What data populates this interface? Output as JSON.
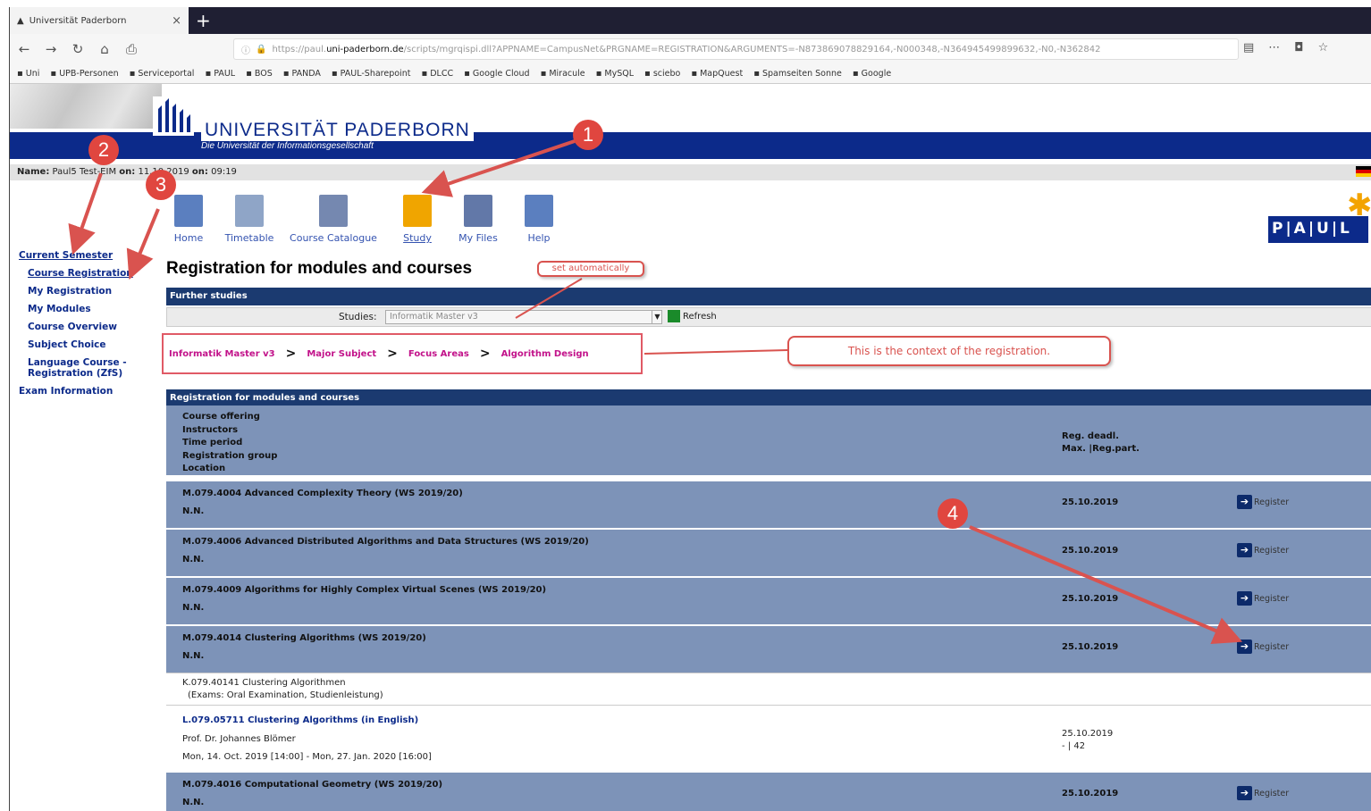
{
  "browser": {
    "tab_title": "Universität Paderborn",
    "url_prefix": "https://paul.",
    "url_domain": "uni-paderborn.de",
    "url_rest": "/scripts/mgrqispi.dll?APPNAME=CampusNet&PRGNAME=REGISTRATION&ARGUMENTS=-N873869078829164,-N000348,-N364945499899632,-N0,-N362842",
    "bookmarks": [
      "Uni",
      "UPB-Personen",
      "Serviceportal",
      "PAUL",
      "BOS",
      "PANDA",
      "PAUL-Sharepoint",
      "DLCC",
      "Google Cloud",
      "Miracule",
      "MySQL",
      "sciebo",
      "MapQuest",
      "Spamseiten Sonne",
      "Google"
    ]
  },
  "header": {
    "uni_name": "UNIVERSITÄT PADERBORN",
    "uni_subtitle": "Die Universität der Informationsgesellschaft",
    "user_label": "Name:",
    "user_text": "Paul5 Test-EIM",
    "date_label": "on:",
    "date_text": "11.10.2019",
    "time_label": "on:",
    "time_text": "09:19",
    "paul_logo": "P|A|U|L"
  },
  "app_icons": [
    {
      "label": "Home",
      "color": "#5b7fbf"
    },
    {
      "label": "Timetable",
      "color": "#8fa5c7"
    },
    {
      "label": "Course Catalogue",
      "color": "#7588b0"
    },
    {
      "label": "Study",
      "color": "#f0a500"
    },
    {
      "label": "My Files",
      "color": "#6278a8"
    },
    {
      "label": "Help",
      "color": "#5b7fbf"
    }
  ],
  "sidebar": {
    "items": [
      {
        "label": "Current Semester"
      },
      {
        "label": "Course Registration"
      },
      {
        "label": "My Registration"
      },
      {
        "label": "My Modules"
      },
      {
        "label": "Course Overview"
      },
      {
        "label": "Subject Choice"
      },
      {
        "label": "Language Course - Registration (ZfS)"
      },
      {
        "label": "Exam Information"
      }
    ]
  },
  "main": {
    "title": "Registration for modules and courses",
    "further_studies_label": "Further studies",
    "studies_label": "Studies:",
    "studies_value": "Informatik Master v3",
    "refresh_label": "Refresh",
    "breadcrumbs": [
      "Informatik Master v3",
      "Major Subject",
      "Focus Areas",
      "Algorithm Design"
    ],
    "breadcrumb_sep": ">",
    "table_title": "Registration for modules and courses",
    "header_lines": [
      "Course offering",
      "Instructors",
      "Time period",
      "Registration group",
      "Location"
    ],
    "header_right": [
      "Reg. deadl.",
      "Max. |Reg.part."
    ],
    "register_label": "Register",
    "courses": [
      {
        "name": "M.079.4004 Advanced Complexity Theory (WS 2019/20)",
        "instructor": "N.N.",
        "deadline": "25.10.2019"
      },
      {
        "name": "M.079.4006 Advanced Distributed Algorithms and Data Structures (WS 2019/20)",
        "instructor": "N.N.",
        "deadline": "25.10.2019"
      },
      {
        "name": "M.079.4009 Algorithms for Highly Complex Virtual Scenes (WS 2019/20)",
        "instructor": "N.N.",
        "deadline": "25.10.2019"
      },
      {
        "name": "M.079.4014 Clustering Algorithms (WS 2019/20)",
        "instructor": "N.N.",
        "deadline": "25.10.2019"
      }
    ],
    "exam_line1": "K.079.40141 Clustering Algorithmen",
    "exam_line2": "(Exams: Oral Examination, Studienleistung)",
    "sub_course": {
      "name": "L.079.05711 Clustering Algorithms (in English)",
      "instructor": "Prof. Dr. Johannes Blömer",
      "period": "Mon, 14. Oct. 2019 [14:00] - Mon, 27. Jan. 2020 [16:00]",
      "deadline": "25.10.2019",
      "capacity": "- | 42"
    },
    "last_course": {
      "name": "M.079.4016 Computational Geometry (WS 2019/20)",
      "instructor": "N.N.",
      "deadline": "25.10.2019"
    }
  },
  "annotations": {
    "set_auto": "set automatically",
    "context_note": "This is the context of the registration.",
    "numbers": [
      "1",
      "2",
      "3",
      "4"
    ],
    "color": "#d9534f"
  }
}
